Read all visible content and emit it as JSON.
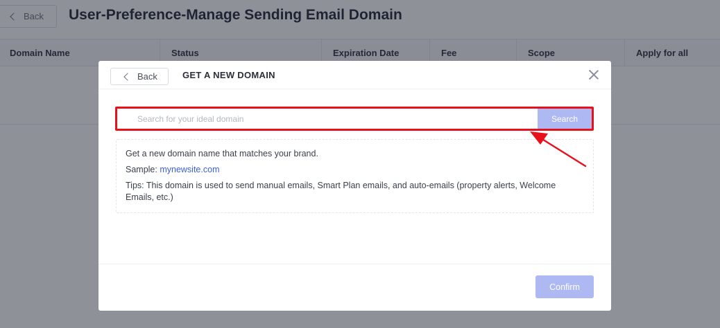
{
  "page": {
    "back_label": "Back",
    "title": "User-Preference-Manage Sending Email Domain"
  },
  "table": {
    "columns": [
      "Domain Name",
      "Status",
      "Expiration Date",
      "Fee",
      "Scope",
      "Apply for all"
    ]
  },
  "modal": {
    "back_label": "Back",
    "title": "GET A NEW DOMAIN",
    "search": {
      "placeholder": "Search for your ideal domain",
      "value": "",
      "button_label": "Search"
    },
    "info": {
      "line1": "Get a new domain name that matches your brand.",
      "sample_label": "Sample: ",
      "sample_link": "mynewsite.com",
      "tips": "Tips: This domain is used to send manual emails, Smart Plan emails, and auto-emails (property alerts, Welcome Emails, etc.)"
    },
    "confirm_label": "Confirm"
  },
  "colors": {
    "highlight": "#e8101b",
    "primary_disabled": "#aeb9f3",
    "link": "#3c5fd9"
  }
}
